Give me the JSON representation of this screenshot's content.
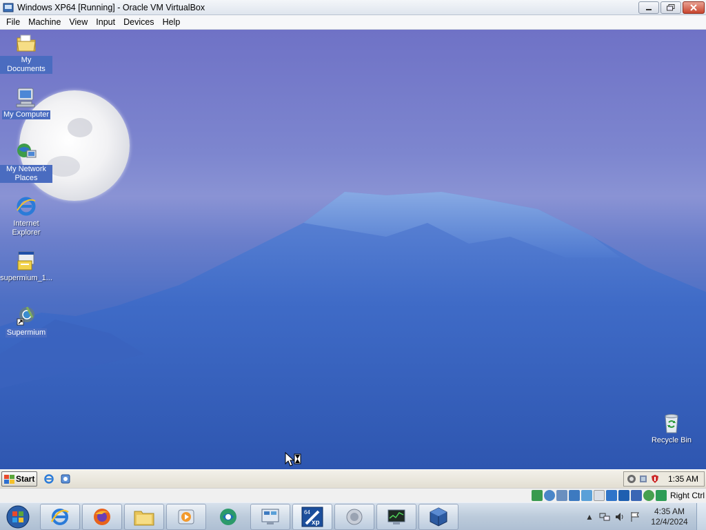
{
  "window": {
    "title": "Windows XP64 [Running] - Oracle VM VirtualBox",
    "menu": [
      "File",
      "Machine",
      "View",
      "Input",
      "Devices",
      "Help"
    ]
  },
  "desktop": {
    "icons": [
      {
        "label": "My Documents",
        "icon": "my-documents-icon"
      },
      {
        "label": "My Computer",
        "icon": "my-computer-icon"
      },
      {
        "label": "My Network Places",
        "icon": "network-places-icon"
      },
      {
        "label": "Internet Explorer",
        "icon": "internet-explorer-icon"
      },
      {
        "label": "supermium_1...",
        "icon": "installer-icon"
      },
      {
        "label": "Supermium",
        "icon": "supermium-icon"
      }
    ],
    "recycle_bin": {
      "label": "Recycle Bin",
      "icon": "recycle-bin-icon"
    }
  },
  "xp_taskbar": {
    "start_label": "Start",
    "quick_launch": [
      "internet-explorer-icon",
      "show-desktop-icon"
    ],
    "tray_icons": [
      "sync-icon",
      "network-icon",
      "shield-icon"
    ],
    "clock": "1:35 AM"
  },
  "vbox_status": {
    "host_key": "Right Ctrl"
  },
  "host_taskbar": {
    "apps": [
      "internet-explorer-icon",
      "firefox-icon",
      "file-explorer-icon",
      "media-player-icon",
      "green-app-icon",
      "remote-desktop-icon",
      "windows-xp-64-icon",
      "speaker-app-icon",
      "task-monitor-icon",
      "virtualbox-icon"
    ],
    "time": "4:35 AM",
    "date": "12/4/2024"
  }
}
